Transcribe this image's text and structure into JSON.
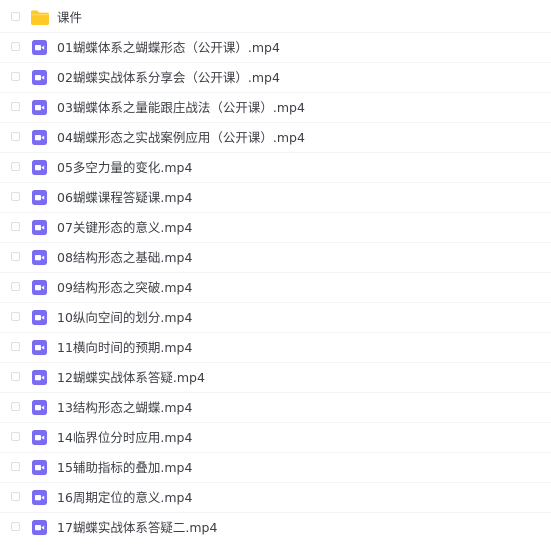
{
  "files": [
    {
      "name": "课件",
      "type": "folder",
      "icon": "folder-icon",
      "color": "#ffca28"
    },
    {
      "name": "01蝴蝶体系之蝴蝶形态（公开课）.mp4",
      "type": "video",
      "icon": "video-file-icon",
      "color": "#7a6cf2"
    },
    {
      "name": "02蝴蝶实战体系分享会（公开课）.mp4",
      "type": "video",
      "icon": "video-file-icon",
      "color": "#7a6cf2"
    },
    {
      "name": "03蝴蝶体系之量能跟庄战法（公开课）.mp4",
      "type": "video",
      "icon": "video-file-icon",
      "color": "#7a6cf2"
    },
    {
      "name": "04蝴蝶形态之实战案例应用（公开课）.mp4",
      "type": "video",
      "icon": "video-file-icon",
      "color": "#7a6cf2"
    },
    {
      "name": "05多空力量的变化.mp4",
      "type": "video",
      "icon": "video-file-icon",
      "color": "#7a6cf2"
    },
    {
      "name": "06蝴蝶课程答疑课.mp4",
      "type": "video",
      "icon": "video-file-icon",
      "color": "#7a6cf2"
    },
    {
      "name": "07关键形态的意义.mp4",
      "type": "video",
      "icon": "video-file-icon",
      "color": "#7a6cf2"
    },
    {
      "name": "08结构形态之基础.mp4",
      "type": "video",
      "icon": "video-file-icon",
      "color": "#7a6cf2"
    },
    {
      "name": "09结构形态之突破.mp4",
      "type": "video",
      "icon": "video-file-icon",
      "color": "#7a6cf2"
    },
    {
      "name": "10纵向空间的划分.mp4",
      "type": "video",
      "icon": "video-file-icon",
      "color": "#7a6cf2"
    },
    {
      "name": "11横向时间的预期.mp4",
      "type": "video",
      "icon": "video-file-icon",
      "color": "#7a6cf2"
    },
    {
      "name": "12蝴蝶实战体系答疑.mp4",
      "type": "video",
      "icon": "video-file-icon",
      "color": "#7a6cf2"
    },
    {
      "name": "13结构形态之蝴蝶.mp4",
      "type": "video",
      "icon": "video-file-icon",
      "color": "#7a6cf2"
    },
    {
      "name": "14临界位分时应用.mp4",
      "type": "video",
      "icon": "video-file-icon",
      "color": "#7a6cf2"
    },
    {
      "name": "15辅助指标的叠加.mp4",
      "type": "video",
      "icon": "video-file-icon",
      "color": "#7a6cf2"
    },
    {
      "name": "16周期定位的意义.mp4",
      "type": "video",
      "icon": "video-file-icon",
      "color": "#7a6cf2"
    },
    {
      "name": "17蝴蝶实战体系答疑二.mp4",
      "type": "video",
      "icon": "video-file-icon",
      "color": "#7a6cf2"
    }
  ]
}
